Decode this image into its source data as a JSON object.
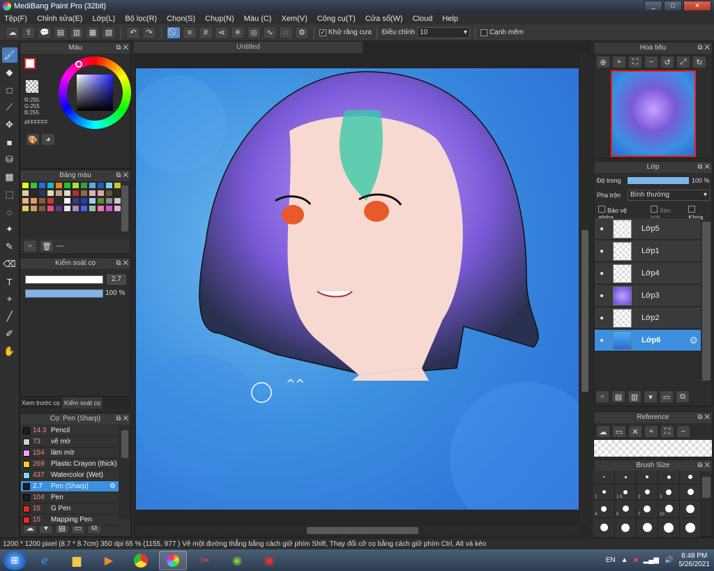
{
  "window": {
    "title": "MediBang Paint Pro (32bit)",
    "btn_min": "_",
    "btn_max": "□",
    "btn_close": "✕"
  },
  "menu": [
    "Tệp(F)",
    "Chỉnh sửa(E)",
    "Lớp(L)",
    "Bộ lọc(R)",
    "Chọn(S)",
    "Chụp(N)",
    "Màu (C)",
    "Xem(V)",
    "Công cụ(T)",
    "Cửa sổ(W)",
    "Cloud",
    "Help"
  ],
  "toolbar": {
    "antialias_label": "Khử răng cưa",
    "adjust_label": "Điều chỉnh",
    "adjust_value": "10",
    "soft_edge_label": "Cạnh mềm"
  },
  "doc_tab": "Untitled",
  "color_panel": {
    "title": "Màu",
    "r": "R:255",
    "g": "G:255",
    "b": "B:255",
    "hex": "#FFFFFF"
  },
  "palette_panel": {
    "title": "Bảng màu",
    "footer_dash": "---",
    "swatches": [
      "#f2f21e",
      "#3fbf3f",
      "#1e6fd9",
      "#1fb5c8",
      "#f27f1e",
      "#1ec81e",
      "#a3e33b",
      "#3ea040",
      "#5fa6e8",
      "#1e5fb5",
      "#7fd0e8",
      "#c8c83b",
      "#d8d2a8",
      "#2b2b2b",
      "#2a3a5a",
      "#e8d9b5",
      "#c8a08a",
      "#e8d8c8",
      "#b03030",
      "#8a6a4a",
      "#d8b5b5",
      "#d8a8a8",
      "#5a5a3a",
      "#3a2a1a",
      "#e8b08a",
      "#d8a060",
      "#8a5a3a",
      "#c83a3a",
      "#2a2a2a",
      "#f2f2f2",
      "#3a3a7a",
      "#1e3fb5",
      "#a8c8e8",
      "#5a8a3a",
      "#8a8a8a",
      "#c8c8c8",
      "#e8c85a",
      "#c8a05a",
      "#7a5a3a",
      "#e84a7a",
      "#5a3a8a",
      "#e8e8e8",
      "#a88ac8",
      "#5a5ae8",
      "#8ac8a8",
      "#e87aa8",
      "#c85ac8",
      "#e8a8d8"
    ]
  },
  "brush_control": {
    "title": "Kiểm soát cọ",
    "size": "2.7",
    "opacity": "100 %"
  },
  "left_tabs": {
    "preview": "Xem trước cọ",
    "control": "Kiểm soát cọ"
  },
  "brush_panel": {
    "title": "Cọ: Pen (Sharp)",
    "items": [
      {
        "size": "14.3",
        "name": "Pencil",
        "color": "#1e1e1e"
      },
      {
        "size": "73",
        "name": "vẽ mờ",
        "color": "#cfcfcf"
      },
      {
        "size": "154",
        "name": "làm mờ",
        "color": "#f5a3e8"
      },
      {
        "size": "269",
        "name": "Plastic Crayon (thick)",
        "color": "#f2d21e"
      },
      {
        "size": "437",
        "name": "Watercolor (Wet)",
        "color": "#7fd8f2"
      },
      {
        "size": "2.7",
        "name": "Pen (Sharp)",
        "color": "#1e1e1e"
      },
      {
        "size": "104",
        "name": "Pen",
        "color": "#1e1e1e"
      },
      {
        "size": "15",
        "name": "G Pen",
        "color": "#e82a2a"
      },
      {
        "size": "15",
        "name": "Mapping Pen",
        "color": "#e82a2a"
      }
    ]
  },
  "navigator": {
    "title": "Hoa tiêu"
  },
  "layer_panel": {
    "title": "Lớp",
    "opacity_label": "Độ trong",
    "opacity_value": "100 %",
    "blend_label": "Pha trộn",
    "blend_value": "Bình thường",
    "protect_alpha": "Bảo vệ alpha",
    "clipping": "Xén bớt",
    "lock": "Khóa",
    "layers": [
      {
        "name": "Lớp5"
      },
      {
        "name": "Lớp1"
      },
      {
        "name": "Lớp4"
      },
      {
        "name": "Lớp3"
      },
      {
        "name": "Lớp2"
      },
      {
        "name": "Lớp6"
      }
    ]
  },
  "reference_panel": {
    "title": "Reference"
  },
  "brush_size_panel": {
    "title": "Brush Size",
    "sizes": [
      "",
      "",
      "",
      "",
      "",
      "1",
      "1.5",
      "2",
      "3",
      "",
      "4",
      "5",
      "7",
      "10",
      "",
      "",
      "",
      "",
      "",
      ""
    ]
  },
  "status": {
    "dims": "1200 * 1200 pixel",
    "cm": "(8.7 * 8.7cm)",
    "dpi": "350 dpi",
    "zoom": "65 %",
    "coords": "(1155, 977 )",
    "hint": "Vẽ một đường thẳng bằng cách giữ phím Shift, Thay đổi cỡ cọ bằng cách giữ phím Ctrl, Alt và kéo"
  },
  "tray": {
    "lang": "EN",
    "time": "8:48 PM",
    "date": "5/26/2021"
  }
}
